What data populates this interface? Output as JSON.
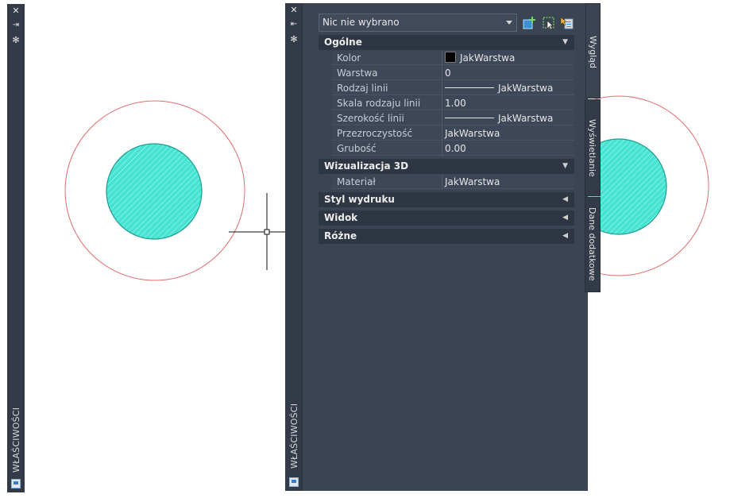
{
  "left_palette": {
    "title": "WŁAŚCIWOŚCI",
    "buttons": [
      "close-icon",
      "autohide-icon",
      "settings-icon"
    ]
  },
  "palette": {
    "title": "WŁAŚCIWOŚCI",
    "selection": "Nic nie wybrano",
    "toolbar": [
      "add-to-selection-icon",
      "select-objects-icon",
      "toggle-pickadd-icon"
    ],
    "sections": {
      "general": {
        "label": "Ogólne",
        "rows": [
          {
            "label": "Kolor",
            "value": "JakWarstwa"
          },
          {
            "label": "Warstwa",
            "value": "0"
          },
          {
            "label": "Rodzaj linii",
            "value": "JakWarstwa"
          },
          {
            "label": "Skala rodzaju linii",
            "value": "1.00"
          },
          {
            "label": "Szerokość linii",
            "value": "JakWarstwa"
          },
          {
            "label": "Przezroczystość",
            "value": "JakWarstwa"
          },
          {
            "label": "Grubość",
            "value": "0.00"
          }
        ]
      },
      "viz3d": {
        "label": "Wizualizacja 3D",
        "rows": [
          {
            "label": "Materiał",
            "value": "JakWarstwa"
          }
        ]
      },
      "plotstyle": {
        "label": "Styl wydruku"
      },
      "view": {
        "label": "Widok"
      },
      "misc": {
        "label": "Różne"
      }
    },
    "tabs": [
      "Wygląd",
      "Wyświetlanie",
      "Dane dodatkowe"
    ]
  },
  "colors": {
    "palette_bg": "#3b4453",
    "circle_outline": "#e06b6b",
    "hatch_fill": "#40e0d0"
  }
}
